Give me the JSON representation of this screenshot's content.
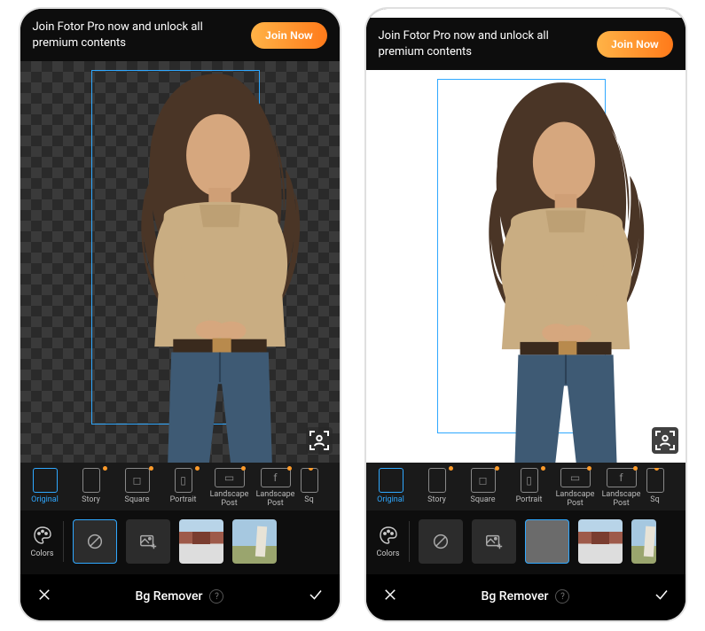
{
  "promo": {
    "text": "Join Fotor Pro now and unlock all premium contents",
    "button_label": "Join Now"
  },
  "ratios": [
    {
      "label": "Original",
      "shape": "square",
      "active": true,
      "pro": false
    },
    {
      "label": "Story",
      "shape": "tall",
      "active": false,
      "pro": true
    },
    {
      "label": "Square",
      "shape": "square",
      "active": false,
      "pro": true,
      "glyph": "◻"
    },
    {
      "label": "Portrait",
      "shape": "tall",
      "active": false,
      "pro": true,
      "glyph": "▯"
    },
    {
      "label": "Landscape Post",
      "shape": "wide",
      "active": false,
      "pro": true,
      "glyph": "▭"
    },
    {
      "label": "Landscape Post",
      "shape": "wide",
      "active": false,
      "pro": true,
      "glyph": "f"
    },
    {
      "label": "Sq",
      "shape": "tall",
      "active": false,
      "pro": true
    }
  ],
  "colors_label": "Colors",
  "bottombar": {
    "title": "Bg Remover",
    "help": "?"
  },
  "screens": [
    {
      "background_kind": "transparent",
      "selected_bg_index": 0
    },
    {
      "background_kind": "white",
      "selected_bg_index": 2
    }
  ]
}
